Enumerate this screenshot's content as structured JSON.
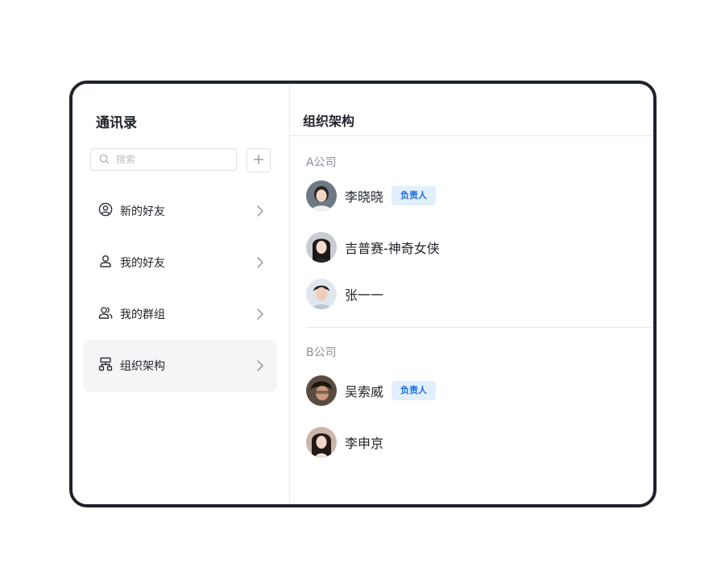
{
  "sidebar": {
    "title": "通讯录",
    "search_placeholder": "搜索",
    "items": [
      {
        "label": "新的好友",
        "icon": "user-circle-icon"
      },
      {
        "label": "我的好友",
        "icon": "user-icon"
      },
      {
        "label": "我的群组",
        "icon": "users-icon"
      },
      {
        "label": "组织架构",
        "icon": "org-chart-icon",
        "active": true
      }
    ]
  },
  "main": {
    "title": "组织架构",
    "groups": [
      {
        "name": "A公司",
        "members": [
          {
            "name": "李晓晓",
            "badge": "负责人"
          },
          {
            "name": "吉普赛-神奇女侠"
          },
          {
            "name": "张一一"
          }
        ]
      },
      {
        "name": "B公司",
        "members": [
          {
            "name": "吴索威",
            "badge": "负责人"
          },
          {
            "name": "李申京"
          }
        ]
      }
    ]
  },
  "colors": {
    "accent": "#1d6fe0",
    "badge_bg": "#e1effe",
    "active_bg": "#f4f5f7",
    "frame": "#1f2229"
  }
}
